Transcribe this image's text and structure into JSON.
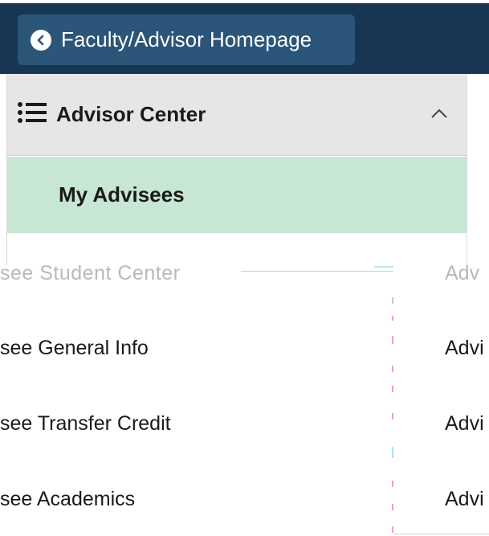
{
  "header": {
    "back_label": "Faculty/Advisor Homepage"
  },
  "nav": {
    "title": "Advisor Center",
    "active_item": "My Advisees"
  },
  "rows": [
    {
      "label": "see Student Center",
      "right": "Adv"
    },
    {
      "label": "see General Info",
      "right": "Advi"
    },
    {
      "label": "see Transfer Credit",
      "right": "Advi"
    },
    {
      "label": "see Academics",
      "right": "Advi"
    }
  ],
  "colors": {
    "header_bg": "#173651",
    "back_button_bg": "#2b5579",
    "nav_header_bg": "#e6e6e6",
    "active_item_bg": "#c7e6d3"
  },
  "icons": {
    "back": "chevron-left-icon",
    "nav": "list-icon",
    "collapse": "chevron-up-icon"
  }
}
